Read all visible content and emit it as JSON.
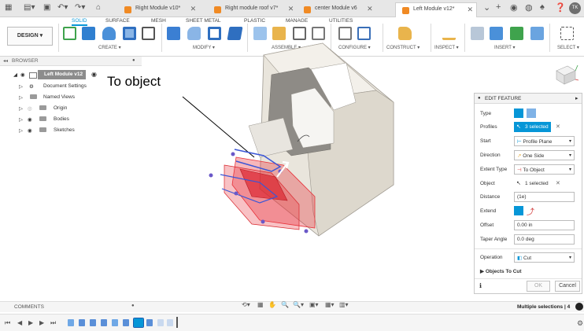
{
  "tabs": {
    "items": [
      {
        "label": "Right Module v10*"
      },
      {
        "label": "Right module roof v7*"
      },
      {
        "label": "center Module v6"
      },
      {
        "label": "Left Module v12*"
      }
    ]
  },
  "ribbon": {
    "tabs": [
      "SOLID",
      "SURFACE",
      "MESH",
      "SHEET METAL",
      "PLASTIC",
      "MANAGE",
      "UTILITIES"
    ],
    "workspace": "DESIGN",
    "groups": [
      "CREATE",
      "MODIFY",
      "ASSEMBLE",
      "CONFIGURE",
      "CONSTRUCT",
      "INSPECT",
      "INSERT",
      "SELECT"
    ]
  },
  "browser": {
    "title": "BROWSER",
    "root": "Left Module v12",
    "items": [
      "Document Settings",
      "Named Views",
      "Origin",
      "Bodies",
      "Sketches"
    ]
  },
  "canvas": {
    "callout": "To object"
  },
  "panel": {
    "title": "EDIT FEATURE",
    "rows": {
      "type": "Type",
      "profiles": "Profiles",
      "start": "Start",
      "direction": "Direction",
      "extent_type": "Extent Type",
      "object": "Object",
      "distance": "Distance",
      "extend": "Extend",
      "offset": "Offset",
      "taper_angle": "Taper Angle",
      "operation": "Operation"
    },
    "values": {
      "profiles": "3 selected",
      "start": "Profile Plane",
      "direction": "One Side",
      "extent_type": "To Object",
      "object": "1 selected",
      "distance": "(1e)",
      "offset": "0.00 in",
      "taper_angle": "0.0 deg",
      "operation": "Cut"
    },
    "objects_to_cut": "Objects To Cut",
    "ok": "OK",
    "cancel": "Cancel"
  },
  "bottom": {
    "comments": "COMMENTS",
    "status": "Multiple selections | 4"
  },
  "colors": {
    "accent": "#0696d7",
    "body": "#e9e5dc",
    "cut_preview": "#e8323a",
    "selection": "#3b56d6"
  }
}
